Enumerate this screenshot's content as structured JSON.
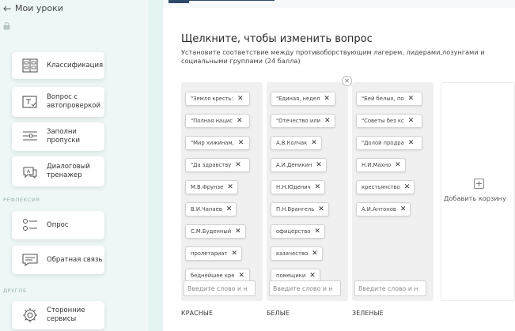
{
  "sidebar": {
    "back_label": "Мои уроки",
    "sections": {
      "reflection": "РЕФЛЕКСИЯ",
      "other": "ДРУГОЕ"
    },
    "tools": [
      {
        "label": "Классификация",
        "icon": "classification-icon"
      },
      {
        "label": "Вопрос с автопроверкой",
        "icon": "autocheck-question-icon"
      },
      {
        "label": "Заполни пропуски",
        "icon": "fill-gaps-icon"
      },
      {
        "label": "Диалоговый тренажер",
        "icon": "dialog-trainer-icon"
      },
      {
        "label": "Опрос",
        "icon": "poll-icon"
      },
      {
        "label": "Обратная связь",
        "icon": "feedback-icon"
      },
      {
        "label": "Сторонние сервисы",
        "icon": "gear-icon"
      }
    ]
  },
  "main": {
    "title": "Щелкните, чтобы изменить вопрос",
    "description": "Установите соответствие между противоборствующим лагерем, лидерами,лозунгами и социальными группами (24 балла)",
    "input_placeholder": "Введите слово и н",
    "add_basket_label": "Добавить корзину",
    "baskets": [
      {
        "name": "КРАСНЫЕ",
        "items": [
          "\"Земля кресть:",
          "\"Полная нацис",
          "\"Мир хижинам,",
          "\"Да здравству",
          "М.В.Фрунзе",
          "В.И.Чапаев",
          "С.М.Буденный",
          "пролетариат",
          "беднейшее кре"
        ]
      },
      {
        "name": "БЕЛЫЕ",
        "items": [
          "\"Единая, недел",
          "\"Отечество или",
          "А.В.Колчак",
          "А.И.Деникин",
          "Н.Н.Юденич",
          "П.Н.Врангель",
          "офицерство",
          "казачество",
          "помещики"
        ]
      },
      {
        "name": "ЗЕЛЕНЫЕ",
        "items": [
          "\"Бей белых, по",
          "\"Советы без кс",
          "\"Долой продра",
          "Н.И.Махно",
          "крестьянство",
          "А.И.Антонов"
        ]
      }
    ]
  },
  "colors": {
    "accent": "#2e4a6b",
    "page_bg": "#e3f4f2",
    "basket_bg": "#f0f0f0"
  }
}
